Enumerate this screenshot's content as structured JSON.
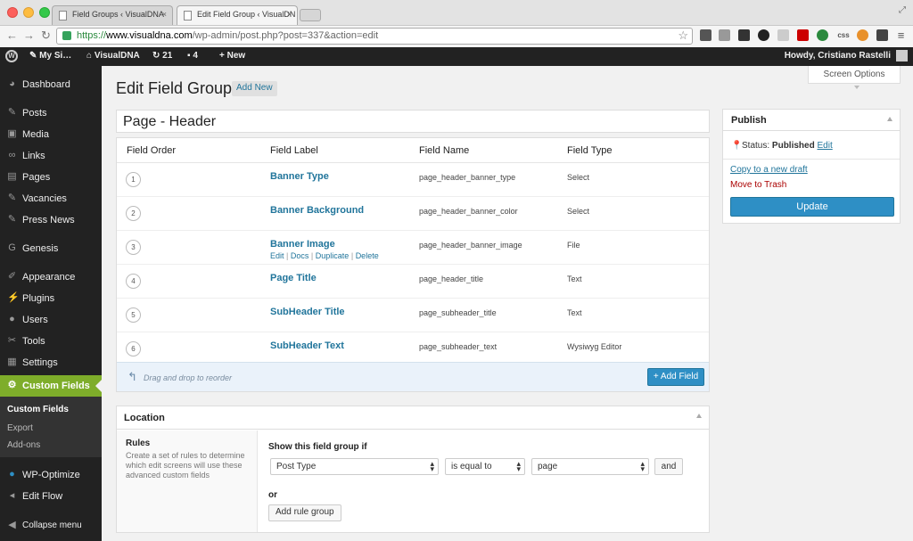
{
  "browser": {
    "tabs": [
      {
        "title": "Field Groups ‹ VisualDNA",
        "close": "×"
      },
      {
        "title": "Edit Field Group ‹ VisualDN",
        "close": "×"
      }
    ],
    "url_https": "https://",
    "url_host": "www.visualdna.com",
    "url_path": "/wp-admin/post.php?post=337&action=edit",
    "back": "←",
    "forward": "→",
    "reload": "↻",
    "ext_css": "css"
  },
  "adminbar": {
    "site_short": "My Si…",
    "site_name": "VisualDNA",
    "updates_count": "21",
    "comments_count": "4",
    "new_label": "New",
    "howdy": "Howdy, Cristiano Rastelli"
  },
  "sidebar": {
    "items": [
      {
        "label": "Dashboard",
        "icon": "dashboard-icon"
      },
      {
        "label": "Posts",
        "icon": "pin-icon"
      },
      {
        "label": "Media",
        "icon": "media-icon"
      },
      {
        "label": "Links",
        "icon": "link-icon"
      },
      {
        "label": "Pages",
        "icon": "pages-icon"
      },
      {
        "label": "Vacancies",
        "icon": "pin-icon"
      },
      {
        "label": "Press News",
        "icon": "pin-icon"
      },
      {
        "label": "Genesis",
        "icon": "genesis-icon"
      },
      {
        "label": "Appearance",
        "icon": "brush-icon"
      },
      {
        "label": "Plugins",
        "icon": "plug-icon"
      },
      {
        "label": "Users",
        "icon": "user-icon"
      },
      {
        "label": "Tools",
        "icon": "wrench-icon"
      },
      {
        "label": "Settings",
        "icon": "settings-icon"
      },
      {
        "label": "Custom Fields",
        "icon": "gear-icon"
      },
      {
        "label": "WP-Optimize",
        "icon": "optimize-icon"
      },
      {
        "label": "Edit Flow",
        "icon": "flow-icon"
      },
      {
        "label": "Collapse menu",
        "icon": "collapse-icon"
      }
    ],
    "submenu": [
      "Custom Fields",
      "Export",
      "Add-ons"
    ]
  },
  "page": {
    "title": "Edit Field Group",
    "add_new": "Add New",
    "screen_options": "Screen Options",
    "group_title": "Page - Header"
  },
  "fields_table": {
    "headers": [
      "Field Order",
      "Field Label",
      "Field Name",
      "Field Type"
    ],
    "rows": [
      {
        "order": "1",
        "label": "Banner Type",
        "name": "page_header_banner_type",
        "type": "Select"
      },
      {
        "order": "2",
        "label": "Banner Background",
        "name": "page_header_banner_color",
        "type": "Select"
      },
      {
        "order": "3",
        "label": "Banner Image",
        "name": "page_header_banner_image",
        "type": "File"
      },
      {
        "order": "4",
        "label": "Page Title",
        "name": "page_header_title",
        "type": "Text"
      },
      {
        "order": "5",
        "label": "SubHeader Title",
        "name": "page_subheader_title",
        "type": "Text"
      },
      {
        "order": "6",
        "label": "SubHeader Text",
        "name": "page_subheader_text",
        "type": "Wysiwyg Editor"
      }
    ],
    "row_actions": {
      "edit": "Edit",
      "docs": "Docs",
      "duplicate": "Duplicate",
      "delete": "Delete",
      "sep": "|"
    },
    "reorder_hint": "Drag and drop to reorder",
    "add_field": "+ Add Field"
  },
  "location": {
    "title": "Location",
    "rules_title": "Rules",
    "rules_desc": "Create a set of rules to determine which edit screens will use these advanced custom fields",
    "show_if": "Show this field group if",
    "param": "Post Type",
    "operator": "is equal to",
    "value": "page",
    "and": "and",
    "or": "or",
    "add_rule_group": "Add rule group"
  },
  "publish": {
    "title": "Publish",
    "status_label": "Status:",
    "status_value": "Published",
    "status_edit": "Edit",
    "copy_draft": "Copy to a new draft",
    "move_trash": "Move to Trash",
    "update": "Update"
  },
  "colors": {
    "accent": "#2e8fc5",
    "current_menu": "#7ead2a",
    "admin_bg": "#222222",
    "link": "#21759b",
    "trash": "#aa0000"
  }
}
